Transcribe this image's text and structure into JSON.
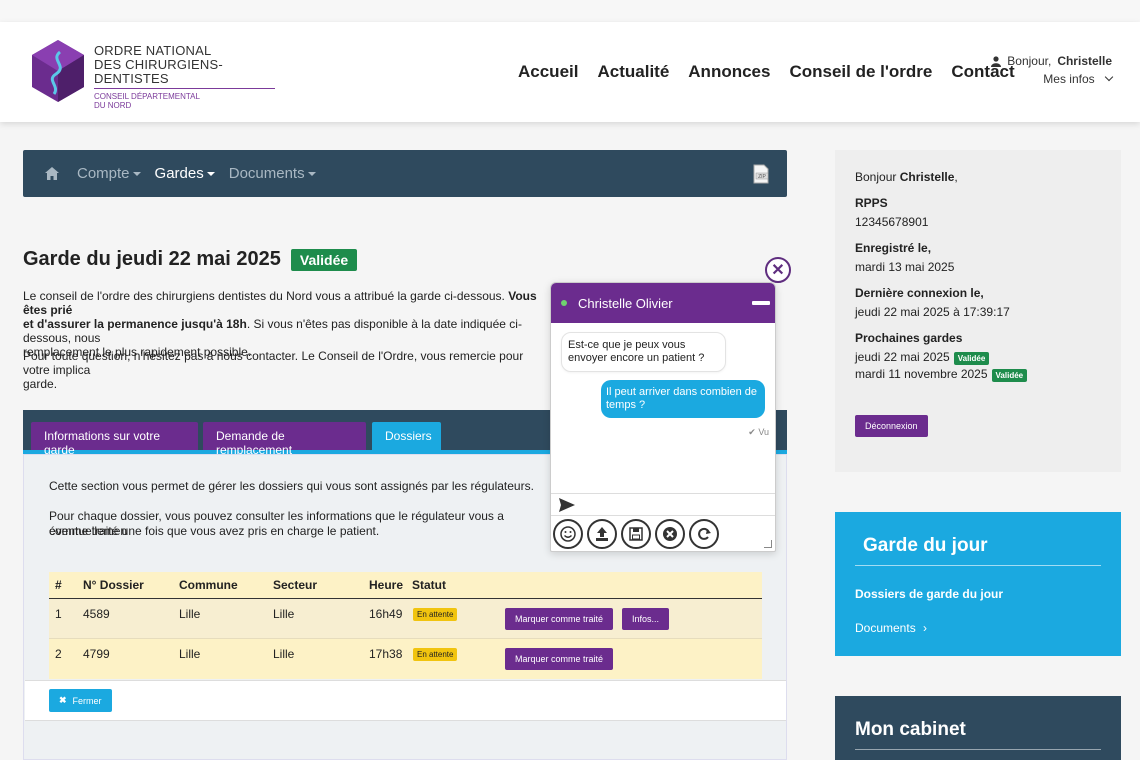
{
  "colors": {
    "purple": "#6b2c8e",
    "blue": "#1ba9e0",
    "navy": "#2f4a5e",
    "green": "#1e8c4c",
    "yellow": "#f1c40f"
  },
  "logo": {
    "line1": "ORDRE NATIONAL",
    "line2": "DES CHIRURGIENS-DENTISTES",
    "line3": "CONSEIL DÉPARTEMENTAL",
    "line4": "DU NORD"
  },
  "nav": [
    "Accueil",
    "Actualité",
    "Annonces",
    "Conseil de l'ordre",
    "Contact"
  ],
  "user": {
    "greeting": "Bonjour,",
    "name": "Christelle",
    "menu": "Mes infos"
  },
  "subnav": {
    "items": [
      "Compte",
      "Gardes",
      "Documents"
    ],
    "active": "Gardes",
    "zip_icon": "zip-file-icon"
  },
  "page": {
    "title": "Garde du jeudi 22 mai 2025",
    "status": "Validée",
    "p1_a": "Le conseil de l'ordre des chirurgiens dentistes du Nord vous a attribué la garde ci-dessous. ",
    "p1_b": "Vous êtes prié",
    "p1_c": "et d'assurer la permanence jusqu'à 18h",
    "p1_d": ". Si vous n'êtes pas disponible à la date indiquée ci-dessous, nous",
    "p1_e": "remplacement le plus rapidement possible.",
    "p2": "Pour toute question, n'hésitez pas à nous contacter. Le Conseil de l'Ordre, vous remercie pour votre implica",
    "p2_b": "garde."
  },
  "tabs": [
    "Informations sur votre garde",
    "Demande de remplacement",
    "Dossiers"
  ],
  "panel": {
    "text1": "Cette section vous permet de gérer les dossiers qui vous sont assignés par les régulateurs.",
    "text2": "Pour chaque dossier, vous pouvez consulter les informations que le régulateur vous a éventuellemen",
    "text3": "comme traité une fois que vous avez pris en charge le patient."
  },
  "table": {
    "headers": [
      "#",
      "N° Dossier",
      "Commune",
      "Secteur",
      "Heure",
      "Statut"
    ],
    "rows": [
      {
        "num": "1",
        "dossier": "4589",
        "commune": "Lille",
        "secteur": "Lille",
        "heure": "16h49",
        "statut": "En attente",
        "btn1": "Marquer comme traité",
        "btn2": "Infos..."
      },
      {
        "num": "2",
        "dossier": "4799",
        "commune": "Lille",
        "secteur": "Lille",
        "heure": "17h38",
        "statut": "En attente",
        "btn1": "Marquer comme traité"
      }
    ]
  },
  "close_button": "Fermer",
  "chat": {
    "name": "Christelle Olivier",
    "incoming": "Est-ce que je peux vous envoyer encore un patient ?",
    "outgoing": "Il peut arriver dans combien de temps ?",
    "seen": "Vu"
  },
  "sidebar": {
    "greeting": "Bonjour",
    "name": "Christelle",
    "rpps_label": "RPPS",
    "rpps": "12345678901",
    "registered_label": "Enregistré le,",
    "registered": "mardi 13 mai 2025",
    "lastlogin_label": "Dernière connexion le,",
    "lastlogin": "jeudi 22 mai 2025 à 17:39:17",
    "next_label": "Prochaines gardes",
    "next1": "jeudi 22 mai 2025",
    "next2": "mardi 11 novembre 2025",
    "badge": "Validée",
    "logout": "Déconnexion"
  },
  "garde_du_jour": {
    "title": "Garde du jour",
    "link1": "Dossiers de garde du jour",
    "link2": "Documents"
  },
  "cabinet": {
    "title": "Mon cabinet"
  }
}
